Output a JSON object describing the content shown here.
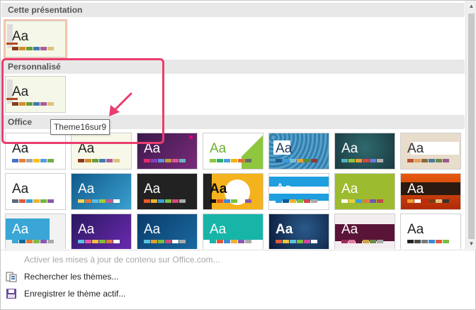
{
  "sections": [
    {
      "name": "section-cette-presentation",
      "label": "Cette présentation"
    },
    {
      "name": "section-personnalise",
      "label": "Personnalisé"
    },
    {
      "name": "section-office",
      "label": "Office"
    }
  ],
  "custom_themes": [
    {
      "name": "theme-current",
      "label": "Aa"
    },
    {
      "name": "theme-custom",
      "label": "Aa"
    }
  ],
  "office_themes": [
    {
      "label": "Aa"
    },
    {
      "label": "Aa"
    },
    {
      "label": "Aa"
    },
    {
      "label": "Aa"
    },
    {
      "label": "Aa"
    },
    {
      "label": "Aa"
    },
    {
      "label": "Aa"
    },
    {
      "label": "Aa"
    },
    {
      "label": "Aa"
    },
    {
      "label": "Aa"
    },
    {
      "label": "Aa"
    },
    {
      "label": "Aa"
    },
    {
      "label": "Aa"
    },
    {
      "label": "Aa"
    },
    {
      "label": "Aa"
    },
    {
      "label": "Aa"
    },
    {
      "label": "Aa"
    },
    {
      "label": "Aa"
    },
    {
      "label": "Aa"
    },
    {
      "label": "Aa"
    },
    {
      "label": "Aa"
    }
  ],
  "tooltip": "Theme16sur9",
  "menu": {
    "activate_updates": "Activer les mises à jour de contenu sur Office.com...",
    "search_themes": "Rechercher les thèmes...",
    "save_theme": "Enregistrer le thème actif..."
  },
  "colors": {
    "highlight": "#ea3d6e"
  }
}
